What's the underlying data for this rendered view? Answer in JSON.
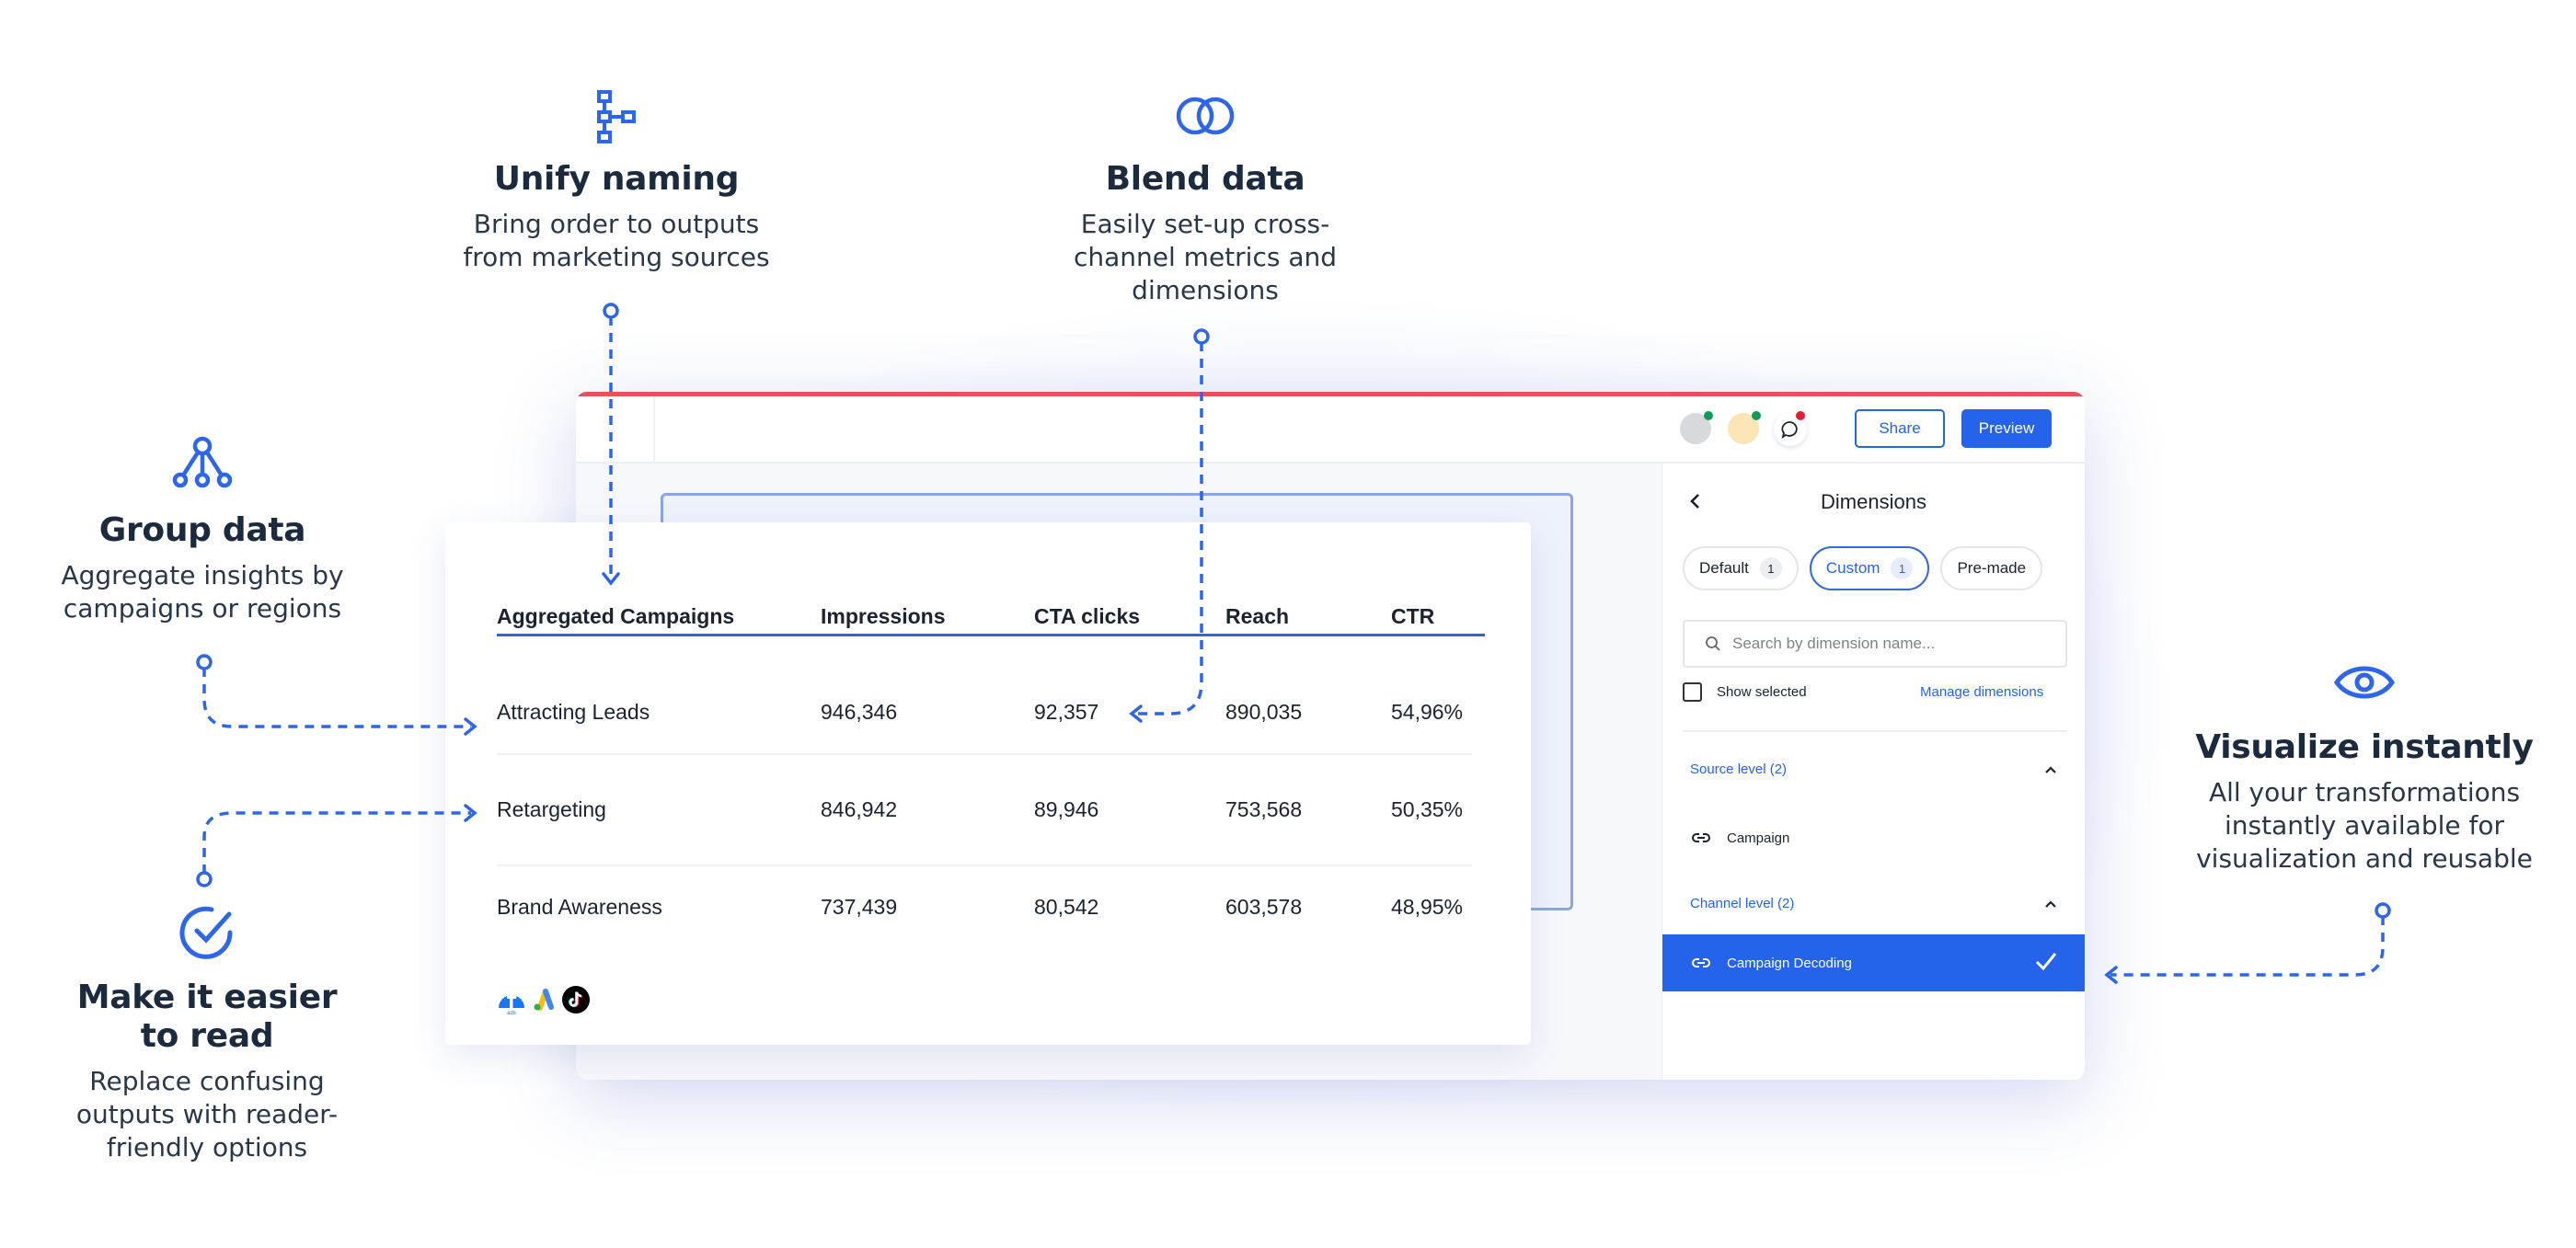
{
  "features": {
    "unify": {
      "title": "Unify naming",
      "desc_lines": [
        "Bring order to outputs",
        "from marketing sources"
      ],
      "icon": "hierarchy-icon"
    },
    "blend": {
      "title": "Blend data",
      "desc_lines": [
        "Easily set-up cross-",
        "channel metrics and",
        "dimensions"
      ],
      "icon": "overlapping-circles-icon"
    },
    "group": {
      "title": "Group data",
      "desc_lines": [
        "Aggregate insights by",
        "campaigns or regions"
      ],
      "icon": "tree-nodes-icon"
    },
    "readable": {
      "title_lines": [
        "Make it easier",
        "to read"
      ],
      "desc_lines": [
        "Replace confusing",
        "outputs with reader-",
        "friendly options"
      ],
      "icon": "check-circle-icon"
    },
    "visualize": {
      "title": "Visualize instantly",
      "desc_lines": [
        "All your transformations",
        "instantly available for",
        "visualization and reusable"
      ],
      "icon": "eye-icon"
    }
  },
  "app": {
    "topbar": {
      "share_label": "Share",
      "preview_label": "Preview",
      "colors": {
        "accent_bar": "#e8505b",
        "primary": "#2563eb"
      }
    },
    "dimensions_panel": {
      "title": "Dimensions",
      "tabs": [
        {
          "label": "Default",
          "count": "1",
          "active": false
        },
        {
          "label": "Custom",
          "count": "1",
          "active": true
        },
        {
          "label": "Pre-made",
          "count": null,
          "active": false
        }
      ],
      "search_placeholder": "Search by dimension name...",
      "show_selected_label": "Show selected",
      "show_selected_checked": false,
      "manage_label": "Manage dimensions",
      "groups": [
        {
          "label": "Source level (2)",
          "items": [
            {
              "label": "Campaign",
              "selected": false
            }
          ]
        },
        {
          "label": "Channel level (2)",
          "items": [
            {
              "label": "Campaign Decoding",
              "selected": true
            }
          ]
        }
      ]
    }
  },
  "table": {
    "columns": [
      "Aggregated Campaigns",
      "Impressions",
      "CTA clicks",
      "Reach",
      "CTR"
    ],
    "rows": [
      [
        "Attracting Leads",
        "946,346",
        "92,357",
        "890,035",
        "54,96%"
      ],
      [
        "Retargeting",
        "846,942",
        "89,946",
        "753,568",
        "50,35%"
      ],
      [
        "Brand Awareness",
        "737,439",
        "80,542",
        "603,578",
        "48,95%"
      ]
    ],
    "sources": [
      "facebook-ads-icon",
      "google-ads-icon",
      "tiktok-icon"
    ],
    "facebook_caption": "ads"
  }
}
